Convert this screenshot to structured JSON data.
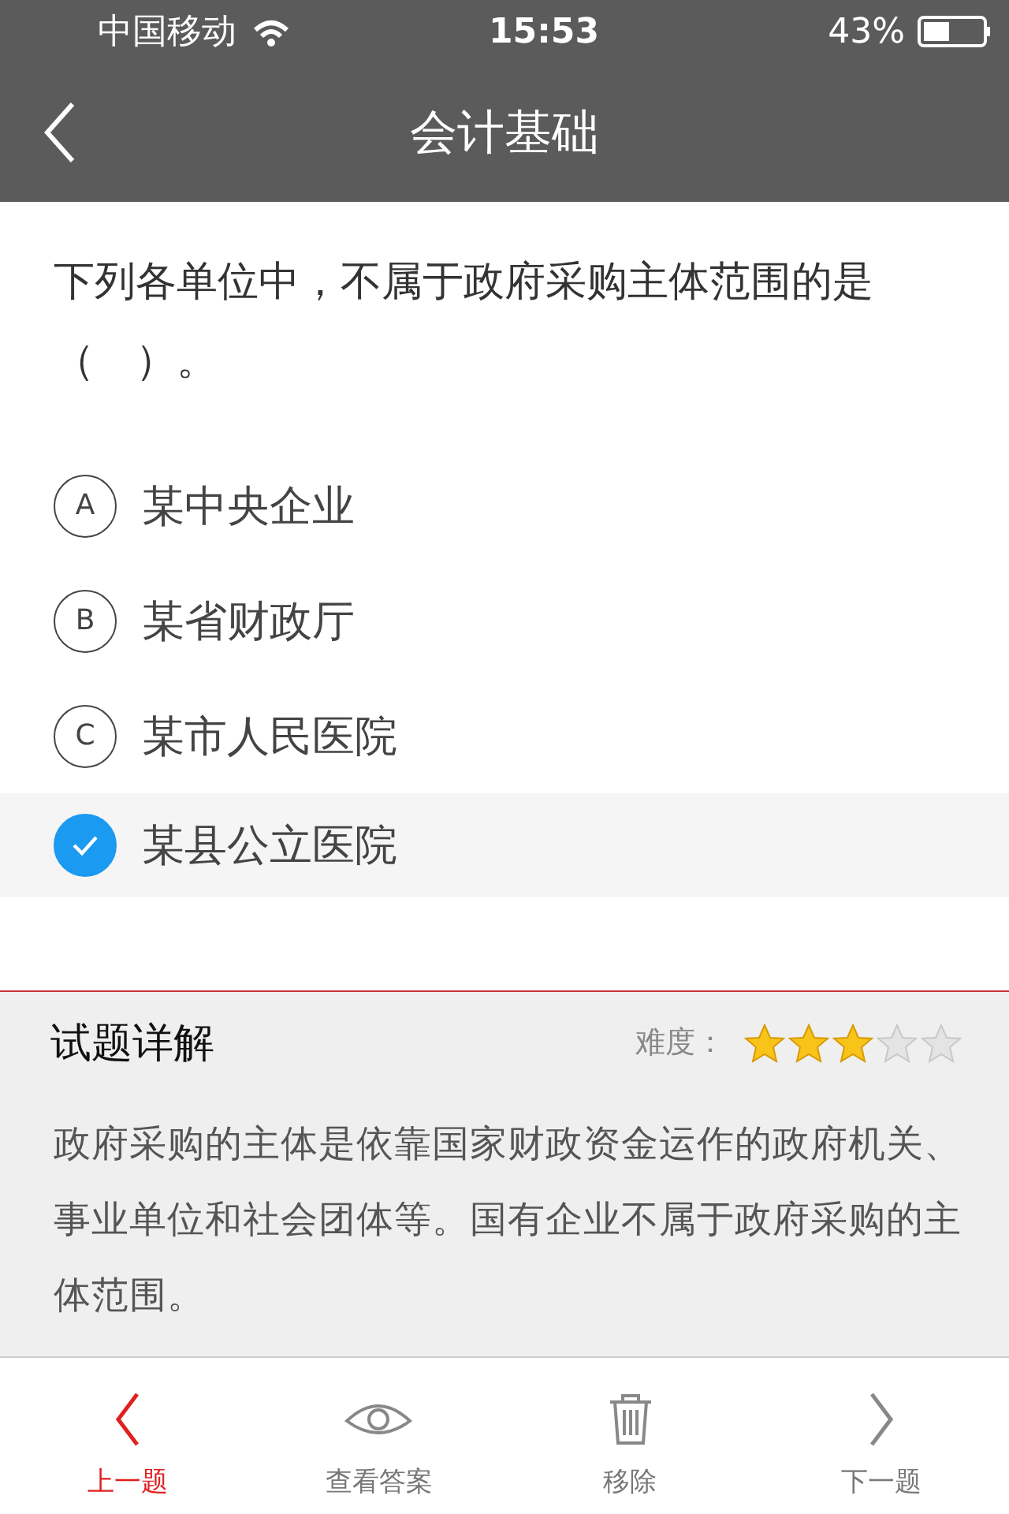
{
  "status_bar": {
    "carrier": "中国移动",
    "time": "15:53",
    "battery": "43%"
  },
  "nav": {
    "title": "会计基础"
  },
  "question": {
    "text": "下列各单位中，不属于政府采购主体范围的是（　）。",
    "options": [
      {
        "letter": "A",
        "text": "某中央企业",
        "selected": false
      },
      {
        "letter": "B",
        "text": "某省财政厅",
        "selected": false
      },
      {
        "letter": "C",
        "text": "某市人民医院",
        "selected": false
      },
      {
        "text": "某县公立医院",
        "selected": true
      }
    ]
  },
  "explanation": {
    "title": "试题详解",
    "difficulty_label": "难度：",
    "stars": 3,
    "text": "政府采购的主体是依靠国家财政资金运作的政府机关、事业单位和社会团体等。国有企业不属于政府采购的主体范围。"
  },
  "toolbar": [
    {
      "kind": "prev",
      "label": "上一题",
      "active": true
    },
    {
      "kind": "answer",
      "label": "查看答案",
      "active": false
    },
    {
      "kind": "remove",
      "label": "移除",
      "active": false
    },
    {
      "kind": "next",
      "label": "下一题",
      "active": false
    }
  ]
}
